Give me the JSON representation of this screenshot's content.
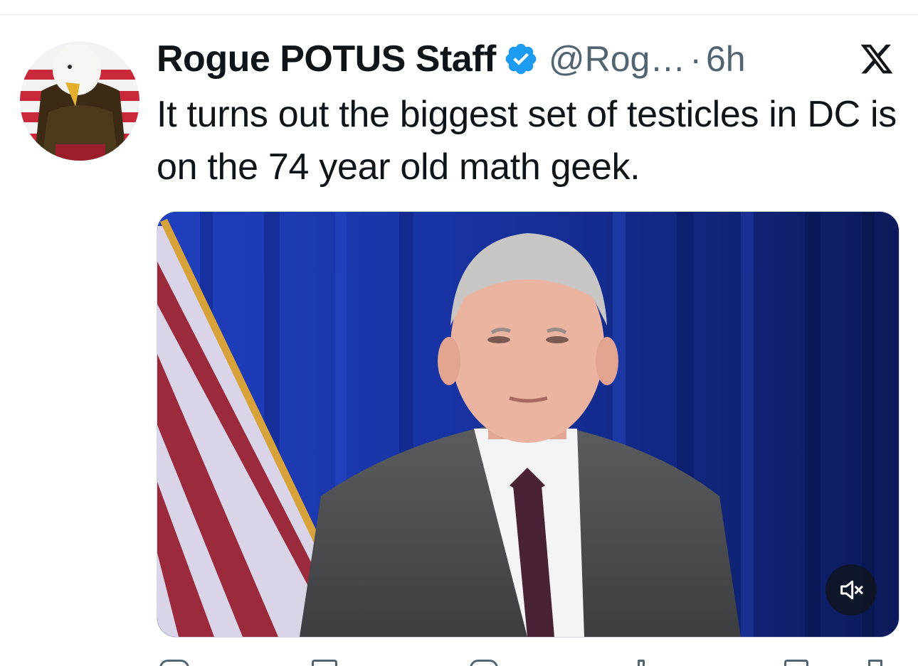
{
  "post": {
    "author": {
      "display_name": "Rogue POTUS Staff",
      "handle": "@Rog…",
      "verified": true
    },
    "separator": "·",
    "timestamp": "6h",
    "text": "It turns out the biggest set of testicles in DC is on the 74 year old math geek.",
    "media": {
      "type": "video",
      "muted": true
    },
    "actions": [
      "reply-icon",
      "repost-icon",
      "like-icon",
      "views-icon",
      "bookmark-icon",
      "share-icon"
    ]
  },
  "colors": {
    "text_primary": "#0f1419",
    "text_secondary": "#536471",
    "verified_blue": "#1d9bf0",
    "divider": "#e6e9ea"
  },
  "icons": {
    "verified": "verified-badge-icon",
    "brand": "x-logo-icon",
    "mute": "volume-muted-icon"
  }
}
